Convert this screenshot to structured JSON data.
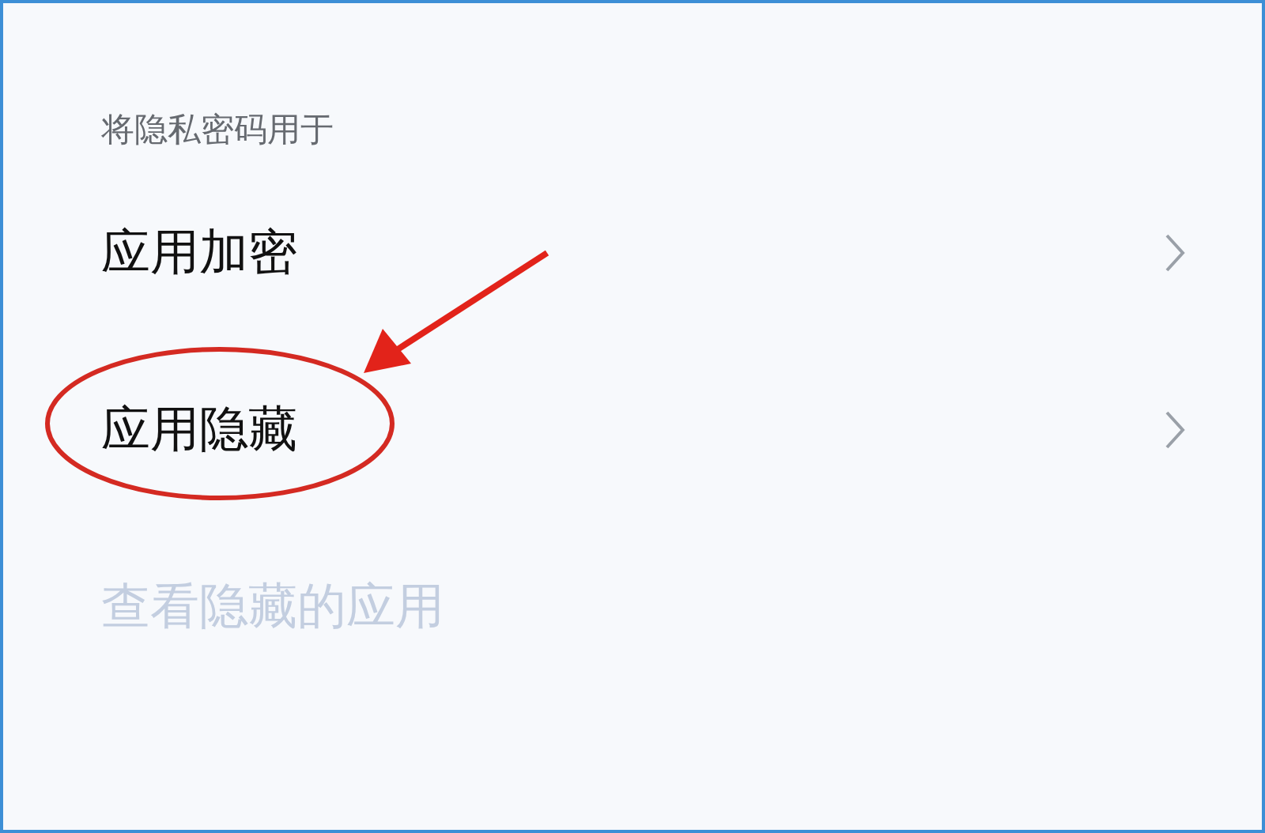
{
  "section": {
    "title": "将隐私密码用于"
  },
  "items": [
    {
      "label": "应用加密",
      "disabled": false,
      "chevron": true,
      "circled": false
    },
    {
      "label": "应用隐藏",
      "disabled": false,
      "chevron": true,
      "circled": true
    },
    {
      "label": "查看隐藏的应用",
      "disabled": true,
      "chevron": false,
      "circled": false
    }
  ],
  "annotation": {
    "arrow": true
  }
}
